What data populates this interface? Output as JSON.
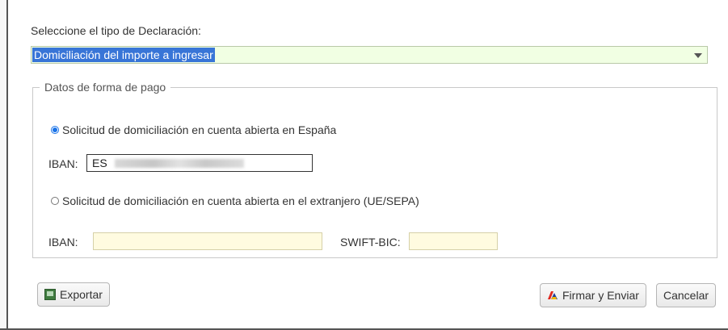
{
  "form": {
    "type_label": "Seleccione el tipo de Declaración:",
    "type_select_value": "Domiciliación del importe a ingresar"
  },
  "payment": {
    "legend": "Datos de forma de pago",
    "option_spain": {
      "label": "Solicitud de domiciliación en cuenta abierta en España",
      "checked": true,
      "iban_label": "IBAN:",
      "iban_value": "ES"
    },
    "option_foreign": {
      "label": "Solicitud de domiciliación en cuenta abierta en el extranjero (UE/SEPA)",
      "checked": false,
      "iban_label": "IBAN:",
      "iban_value": "",
      "swift_label": "SWIFT-BIC:",
      "swift_value": ""
    }
  },
  "actions": {
    "export_label": "Exportar",
    "sign_send_label": "Firmar y Enviar",
    "cancel_label": "Cancelar"
  },
  "colors": {
    "select_bg": "#f1ffe3",
    "select_highlight": "#3875d7",
    "foreign_input_bg": "#fffbe0",
    "radio_checked": "#1a73e8"
  },
  "icons": {
    "export": "export-icon",
    "sign": "firma-icon",
    "select_arrow": "chevron-down-icon"
  }
}
